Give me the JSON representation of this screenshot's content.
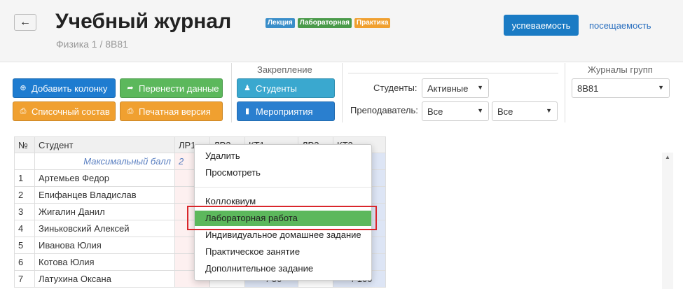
{
  "header": {
    "back_icon": "arrow-left-icon",
    "title": "Учебный журнал",
    "subtitle": "Физика 1 / 8В81",
    "badges": [
      {
        "label": "Лекция",
        "color": "#3a8ec9"
      },
      {
        "label": "Лабораторная",
        "color": "#4a9a4a"
      },
      {
        "label": "Практика",
        "color": "#f0a030"
      }
    ],
    "progress_button": "успеваемость",
    "attendance_link": "посещаемость"
  },
  "toolbar": {
    "add_column": "Добавить колонку",
    "transfer_data": "Перенести данные",
    "list_composition": "Списочный состав",
    "print_version": "Печатная версия",
    "pin_section_label": "Закрепление",
    "pin_students": "Студенты",
    "pin_events": "Мероприятия",
    "students_label": "Студенты:",
    "students_value": "Активные",
    "teacher_label": "Преподаватель:",
    "teacher_value_1": "Все",
    "teacher_value_2": "Все",
    "group_journals_label": "Журналы групп",
    "group_value": "8В81"
  },
  "table": {
    "headers": [
      "№",
      "Студент",
      "ЛР1",
      "ЛР2",
      "КТ1",
      "ЛР3",
      "КТ2"
    ],
    "max_score_label": "Максимальный балл",
    "max_score_values": [
      "2"
    ],
    "rows": [
      {
        "num": "1",
        "name": "Артемьев Федор"
      },
      {
        "num": "2",
        "name": "Епифанцев Владислав"
      },
      {
        "num": "3",
        "name": "Жигалин Данил"
      },
      {
        "num": "4",
        "name": "Зиньковский Алексей"
      },
      {
        "num": "5",
        "name": "Иванова Юлия"
      },
      {
        "num": "6",
        "name": "Котова Юлия"
      },
      {
        "num": "7",
        "name": "Латухина Оксана",
        "kt1": "- / 50",
        "kt2": "- / 100"
      }
    ]
  },
  "context_menu": {
    "items": [
      "Удалить",
      "Просмотреть",
      "Коллоквиум",
      "Лабораторная работа",
      "Индивидуальное домашнее задание",
      "Практическое занятие",
      "Дополнительное задание"
    ],
    "active_color": "#5cb85c"
  },
  "colors": {
    "primary": "#1a7bc4",
    "highlight_border": "#d9262b"
  }
}
